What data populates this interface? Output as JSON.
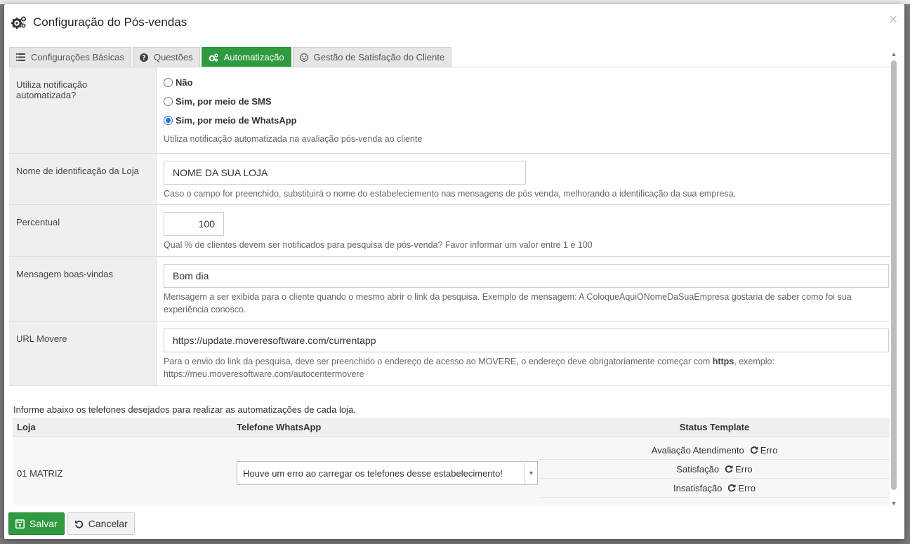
{
  "modal": {
    "title": "Configuração do Pós-vendas",
    "close": "×"
  },
  "tabs": [
    {
      "label": "Configurações Básicas",
      "icon": "list-icon"
    },
    {
      "label": "Questões",
      "icon": "question-circle-icon"
    },
    {
      "label": "Automatização",
      "icon": "cogs-icon",
      "active": true
    },
    {
      "label": "Gestão de Satisfação do Cliente",
      "icon": "smile-icon"
    }
  ],
  "form": {
    "notificacao": {
      "label": "Utiliza notificação automatizada?",
      "options": [
        "Não",
        "Sim, por meio de SMS",
        "Sim, por meio de WhatsApp"
      ],
      "selected": "Sim, por meio de WhatsApp",
      "help": "Utiliza notificação automatizada na avaliação pós-venda ao cliente"
    },
    "nome_loja": {
      "label": "Nome de identificação da Loja",
      "value": "NOME DA SUA LOJA",
      "help": "Caso o campo for preenchido, substituirá o nome do estabeleciemento nas mensagens de pós venda, melhorando a identificação da sua empresa."
    },
    "percentual": {
      "label": "Percentual",
      "value": "100",
      "help": "Qual % de clientes devem ser notificados para pesquisa de pós-venda? Favor informar um valor entre 1 e 100"
    },
    "mensagem": {
      "label": "Mensagem boas-vindas",
      "value": "Bom dia",
      "help": "Mensagem a ser exibida para o cliente quando o mesmo abrir o link da pesquisa. Exemplo de mensagem: A ColoqueAquiONomeDaSuaEmpresa gostaria de saber como foi sua experiência conosco."
    },
    "url": {
      "label": "URL Movere",
      "value": "https://update.moveresoftware.com/currentapp",
      "help_before": "Para o envio do link da pesquisa, deve ser preenchido o endereço de acesso ao MOVERE, o endereço deve obrigatoriamente começar com ",
      "help_bold": "https",
      "help_after": ", exemplo: https://meu.moveresoftware.com/autocentermovere"
    }
  },
  "phones": {
    "info": "Informe abaixo os telefones desejados para realizar as automatizações de cada loja.",
    "headers": {
      "loja": "Loja",
      "telefone": "Telefone WhatsApp",
      "status": "Status Template"
    },
    "rows": [
      {
        "loja": "01 MATRIZ",
        "telefone": "Houve um erro ao carregar os telefones desse estabelecimento!",
        "status": [
          {
            "label": "Avaliação Atendimento",
            "state": "Erro"
          },
          {
            "label": "Satisfação",
            "state": "Erro"
          },
          {
            "label": "Insatisfação",
            "state": "Erro"
          }
        ]
      }
    ]
  },
  "footer": {
    "save": "Salvar",
    "cancel": "Cancelar"
  },
  "colors": {
    "accent": "#2f9a3f",
    "radio": "#1a73e8"
  }
}
